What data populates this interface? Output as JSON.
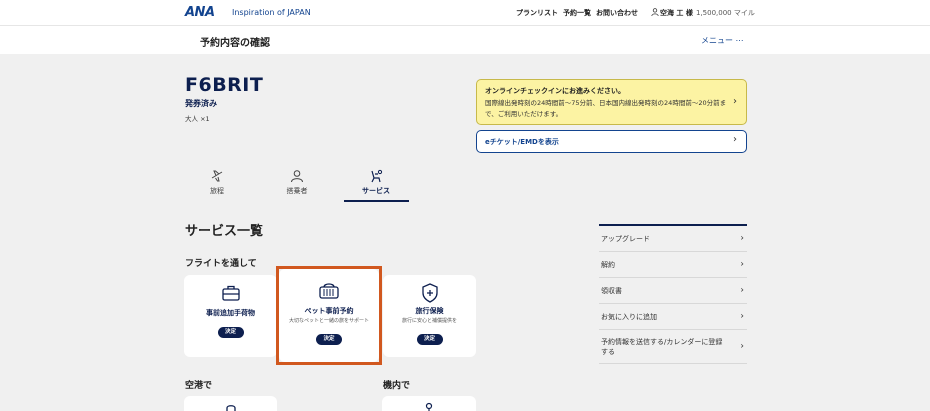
{
  "header": {
    "logo": "ANA",
    "tagline": "Inspiration of JAPAN",
    "nav": [
      "プランリスト",
      "予約一覧",
      "お問い合わせ"
    ],
    "user_name": "空海 工 様",
    "miles": "1,500,000 マイル"
  },
  "subheader": {
    "title": "予約内容の確認",
    "menu_label": "メニュー ⋯"
  },
  "booking": {
    "code": "F6BRIT",
    "status": "発券済み",
    "passengers": "大人 ×1"
  },
  "notice": {
    "title": "オンラインチェックインにお進みください。",
    "body": "国際線出発時刻の24時間前～75分前、日本国内線出発時刻の24時間前～20分前まで、ご利用いただけます。"
  },
  "eticket": {
    "label": "eチケット/EMDを表示"
  },
  "tabs": [
    {
      "label": "旅程",
      "icon": "plane-icon"
    },
    {
      "label": "搭乗者",
      "icon": "person-icon"
    },
    {
      "label": "サービス",
      "icon": "seat-icon",
      "active": true
    }
  ],
  "services": {
    "title": "サービス一覧",
    "groups": {
      "flight": "フライトを通して",
      "airport": "空港で",
      "inflight": "機内で"
    },
    "cards": [
      {
        "title": "事前追加手荷物",
        "desc": "",
        "button": "決定",
        "icon": "baggage-icon"
      },
      {
        "title": "ペット事前予約",
        "desc": "大切なペットと一緒の旅をサポート",
        "button": "決定",
        "icon": "pet-carrier-icon"
      },
      {
        "title": "旅行保険",
        "desc": "旅行に安心と補償提供を",
        "button": "決定",
        "icon": "shield-plus-icon"
      }
    ]
  },
  "side_menu": [
    "アップグレード",
    "解約",
    "領収書",
    "お気に入りに追加",
    "予約情報を送信する/カレンダーに登録する"
  ]
}
